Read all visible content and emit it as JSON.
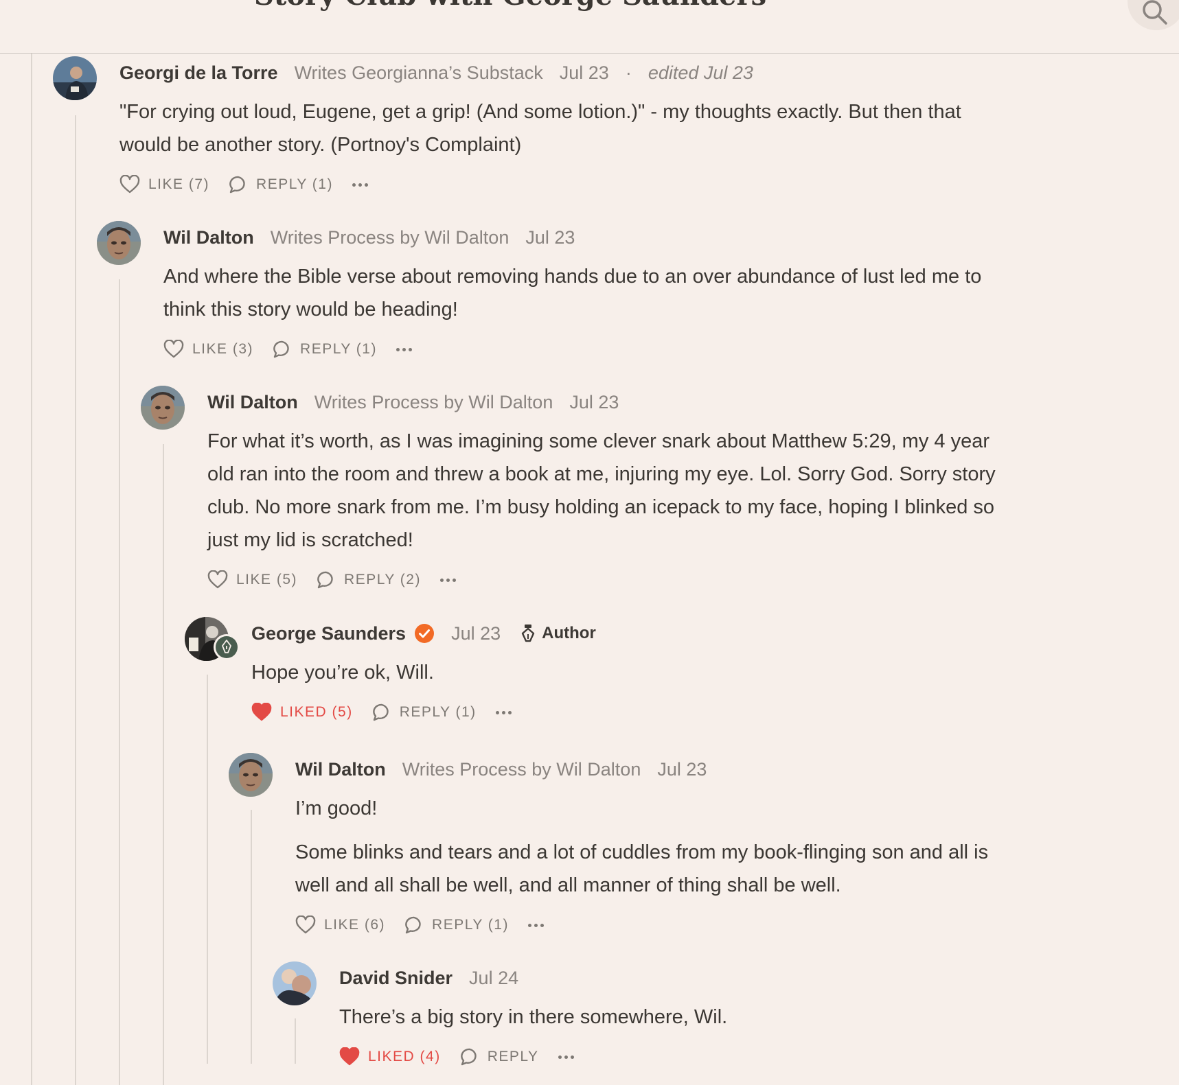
{
  "header": {
    "title": "Story Club with George Saunders"
  },
  "comments": [
    {
      "name": "Georgi de la Torre",
      "subtitle": "Writes Georgianna’s Substack",
      "date": "Jul 23",
      "edited": "edited Jul 23",
      "body": [
        "\"For crying out loud, Eugene, get a grip! (And some lotion.)\" - my thoughts exactly. But then that would be another story. (Portnoy's Complaint)"
      ],
      "like_label": "LIKE (7)",
      "reply_label": "REPLY (1)"
    },
    {
      "name": "Wil Dalton",
      "subtitle": "Writes Process by Wil Dalton",
      "date": "Jul 23",
      "body": [
        "And where the Bible verse about removing hands due to an over abundance of lust led me to think this story would be heading!"
      ],
      "like_label": "LIKE (3)",
      "reply_label": "REPLY (1)"
    },
    {
      "name": "Wil Dalton",
      "subtitle": "Writes Process by Wil Dalton",
      "date": "Jul 23",
      "body": [
        "For what it’s worth, as I was imagining some clever snark about Matthew 5:29, my 4 year old ran into the room and threw a book at me, injuring my eye. Lol. Sorry God. Sorry story club. No more snark from me. I’m busy holding an icepack to my face, hoping I blinked so just my lid is scratched!"
      ],
      "like_label": "LIKE (5)",
      "reply_label": "REPLY (2)"
    },
    {
      "name": "George Saunders",
      "date": "Jul 23",
      "author_label": "Author",
      "body": [
        "Hope you’re ok, Will."
      ],
      "like_label": "LIKED (5)",
      "reply_label": "REPLY (1)"
    },
    {
      "name": "Wil Dalton",
      "subtitle": "Writes Process by Wil Dalton",
      "date": "Jul 23",
      "body": [
        "I’m good!",
        "Some blinks and tears and a lot of cuddles from my book-flinging son and all is well and all shall be well, and all manner of thing shall be well."
      ],
      "like_label": "LIKE (6)",
      "reply_label": "REPLY (1)"
    },
    {
      "name": "David Snider",
      "date": "Jul 24",
      "body": [
        "There’s a big story in there somewhere, Wil."
      ],
      "like_label": "LIKED (4)",
      "reply_label": "REPLY"
    }
  ],
  "icons": {
    "like": "heart-outline-icon",
    "liked": "heart-filled-icon",
    "reply": "speech-bubble-icon",
    "more": "ellipsis-icon",
    "search": "search-icon",
    "verified": "verified-check-icon",
    "author": "pen-nib-icon"
  },
  "colors": {
    "background": "#f7efea",
    "liked": "#e34a45",
    "verified": "#f26a25",
    "muted": "#8a8480"
  }
}
